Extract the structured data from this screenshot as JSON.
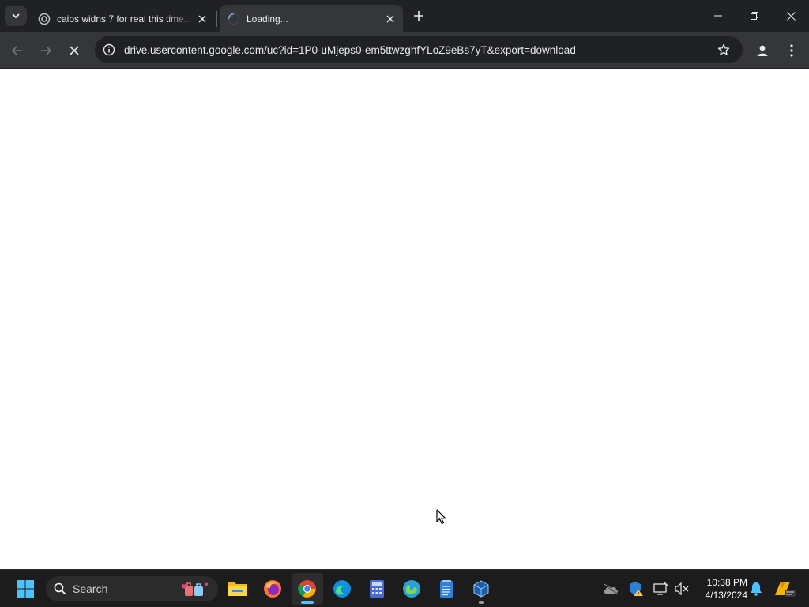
{
  "browser": {
    "tabs": [
      {
        "title": "caios widns 7 for real this time..."
      },
      {
        "title": "Loading..."
      }
    ],
    "url": "drive.usercontent.google.com/uc?id=1P0-uMjeps0-em5ttwzghfYLoZ9eBs7yT&export=download"
  },
  "taskbar": {
    "search_label": "Search",
    "apps": [
      "start-icon",
      "file-explorer-icon",
      "firefox-icon",
      "chrome-icon",
      "edge-icon",
      "calculator-icon",
      "photos-icon",
      "notepad-icon",
      "virtualbox-icon"
    ],
    "clock": {
      "time": "10:38 PM",
      "date": "4/13/2024"
    }
  },
  "colors": {
    "tab_strip": "#202124",
    "toolbar": "#35363a",
    "taskbar": "#1c1c1c",
    "accent": "#4cc2ff"
  }
}
